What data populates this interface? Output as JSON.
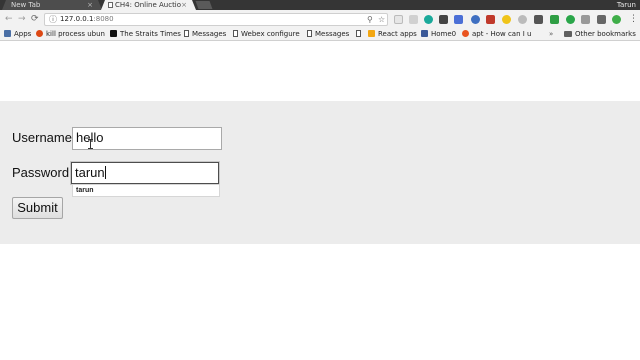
{
  "tabs": [
    {
      "title": "New Tab",
      "close": "×"
    },
    {
      "title": "CH4: Online Auctio",
      "close": "×"
    }
  ],
  "window": {
    "user": "Tarun"
  },
  "toolbar": {
    "back": "←",
    "forward": "→",
    "reload": "⟳",
    "info_icon": "ⓘ",
    "url_host": "127.0.0.1",
    "url_port": ":8080",
    "zoom_icon": "⚲",
    "star_icon": "☆",
    "menu_icon": "⋮"
  },
  "bookmarks": {
    "apps": "Apps",
    "items": [
      "kill process ubun",
      "The Straits Times",
      "Messages",
      "Webex configure",
      "Messages",
      "",
      "React apps",
      "Home0",
      "apt - How can I u"
    ],
    "overflow": "»",
    "other": "Other bookmarks"
  },
  "form": {
    "username_label": "Username:",
    "username_value": "hello",
    "password_label": "Password:",
    "password_value": "tarun",
    "autocomplete_suggestion": "tarun",
    "submit_label": "Submit"
  },
  "colors": {
    "tab_strip": "#353535",
    "toolbar": "#f2f2f2",
    "form_background": "#ececec"
  }
}
